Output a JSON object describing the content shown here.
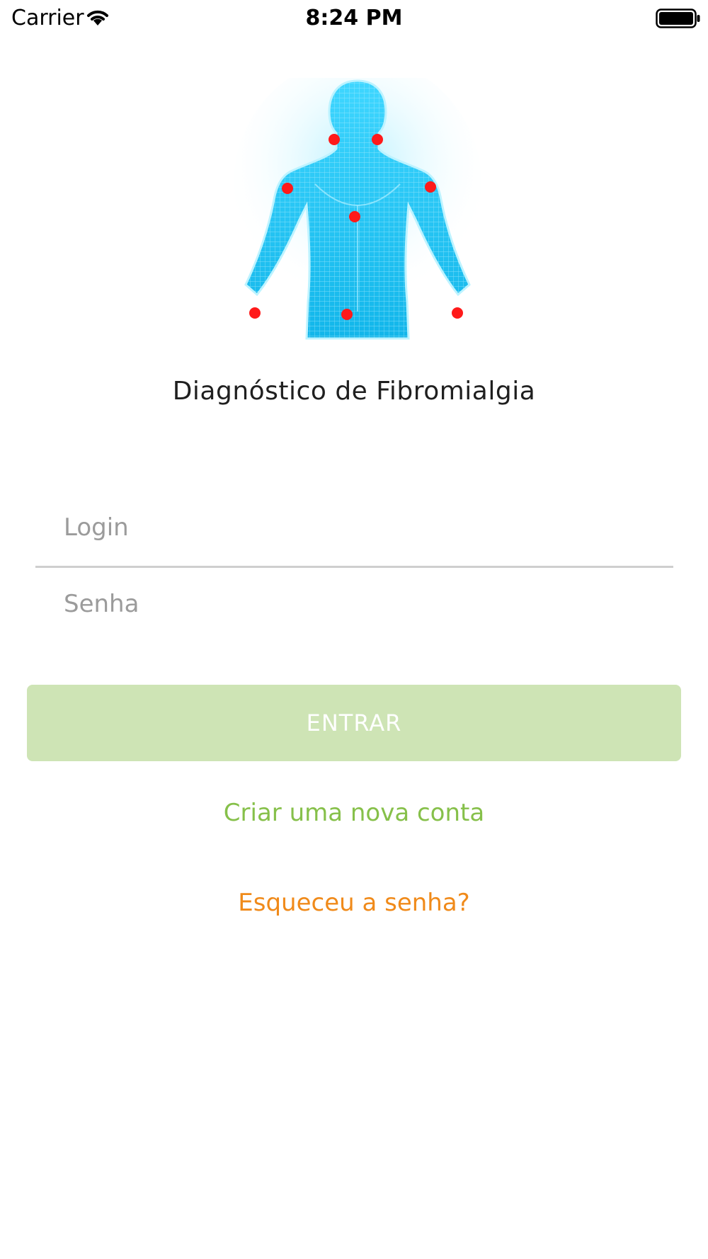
{
  "status_bar": {
    "carrier": "Carrier",
    "time": "8:24 PM",
    "icons": [
      "wifi-icon",
      "battery-icon"
    ]
  },
  "hero": {
    "image": "human-body-tender-points-illustration",
    "figure_color": "#2ac8f0",
    "point_color": "#ff1a1a"
  },
  "app_title": "Diagnóstico de Fibromialgia",
  "form": {
    "login_placeholder": "Login",
    "login_value": "",
    "password_placeholder": "Senha",
    "password_value": "",
    "submit_label": "ENTRAR",
    "submit_color": "#cee4b5"
  },
  "links": {
    "create_account": "Criar uma nova conta",
    "create_account_color": "#86c04a",
    "forgot_password": "Esqueceu a senha?",
    "forgot_password_color": "#f08a1a"
  }
}
